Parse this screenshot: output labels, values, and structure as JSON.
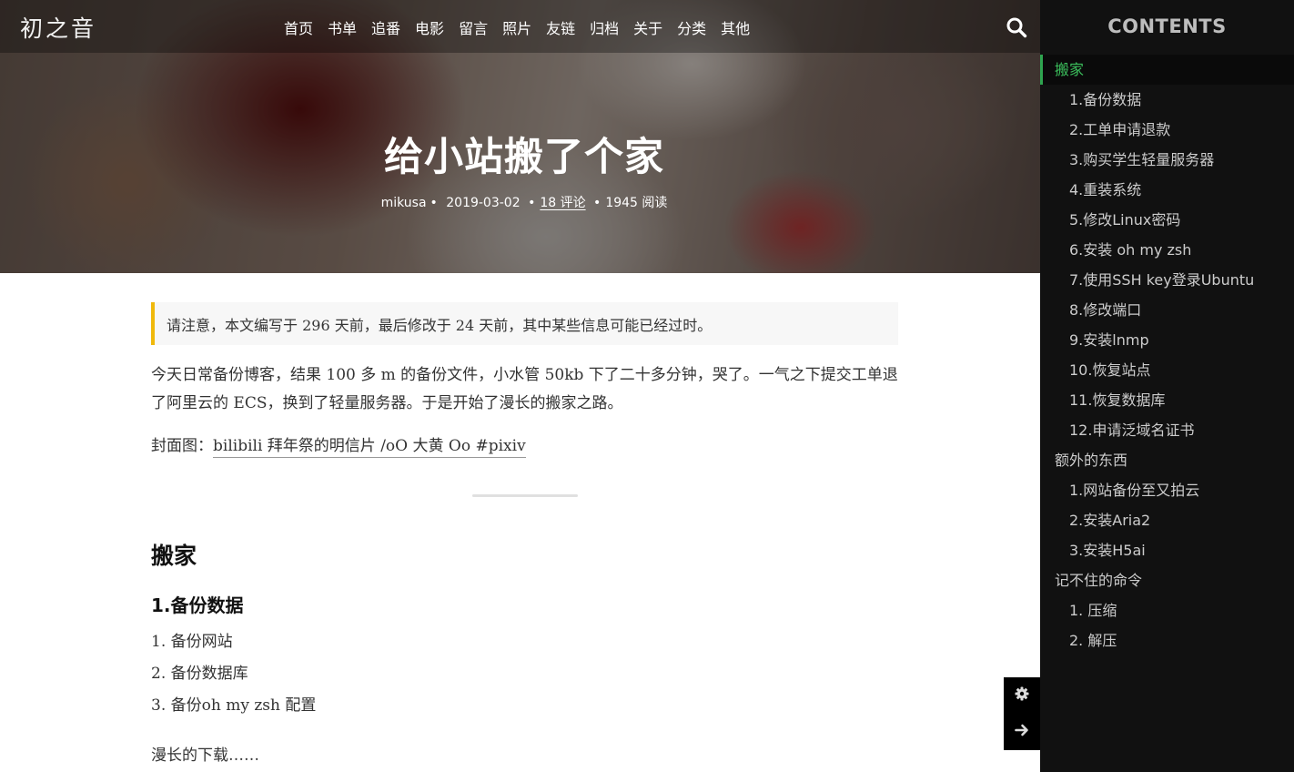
{
  "site": {
    "logo": "初之音",
    "nav": [
      "首页",
      "书单",
      "追番",
      "电影",
      "留言",
      "照片",
      "友链",
      "归档",
      "关于",
      "分类",
      "其他"
    ]
  },
  "post": {
    "title": "给小站搬了个家",
    "author": "mikusa",
    "date": "2019-03-02",
    "comments": "18 评论",
    "views": "1945 阅读"
  },
  "article": {
    "notice": "请注意，本文编写于 296 天前，最后修改于 24 天前，其中某些信息可能已经过时。",
    "intro": "今天日常备份博客，结果 100 多 m 的备份文件，小水管 50kb 下了二十多分钟，哭了。一气之下提交工单退了阿里云的 ECS，换到了轻量服务器。于是开始了漫长的搬家之路。",
    "cover_label": "封面图：",
    "cover_link": "bilibili 拜年祭的明信片 /oO 大黄 Oo #pixiv",
    "h2": "搬家",
    "h3": "1.备份数据",
    "list": [
      "1. 备份网站",
      "2. 备份数据库",
      "3. 备份oh my zsh 配置"
    ],
    "tail": "漫长的下载……"
  },
  "toc": {
    "title": "CONTENTS",
    "items": [
      {
        "label": "搬家",
        "level": 1,
        "active": true
      },
      {
        "label": "1.备份数据",
        "level": 2
      },
      {
        "label": "2.工单申请退款",
        "level": 2
      },
      {
        "label": "3.购买学生轻量服务器",
        "level": 2
      },
      {
        "label": "4.重装系统",
        "level": 2
      },
      {
        "label": "5.修改Linux密码",
        "level": 2
      },
      {
        "label": "6.安装 oh my zsh",
        "level": 2
      },
      {
        "label": "7.使用SSH key登录Ubuntu",
        "level": 2
      },
      {
        "label": "8.修改端口",
        "level": 2
      },
      {
        "label": "9.安装lnmp",
        "level": 2
      },
      {
        "label": "10.恢复站点",
        "level": 2
      },
      {
        "label": "11.恢复数据库",
        "level": 2
      },
      {
        "label": "12.申请泛域名证书",
        "level": 2
      },
      {
        "label": "额外的东西",
        "level": 1
      },
      {
        "label": "1.网站备份至又拍云",
        "level": 2
      },
      {
        "label": "2.安装Aria2",
        "level": 2
      },
      {
        "label": "3.安装H5ai",
        "level": 2
      },
      {
        "label": "记不住的命令",
        "level": 1
      },
      {
        "label": "1. 压缩",
        "level": 2
      },
      {
        "label": "2. 解压",
        "level": 2
      }
    ]
  },
  "icons": {
    "search": "search-icon",
    "settings": "gear-icon",
    "next": "arrow-right-icon"
  },
  "colors": {
    "toc_bg": "#111111",
    "toc_active": "#3bbf5c",
    "notice_accent": "#f0b90b"
  }
}
